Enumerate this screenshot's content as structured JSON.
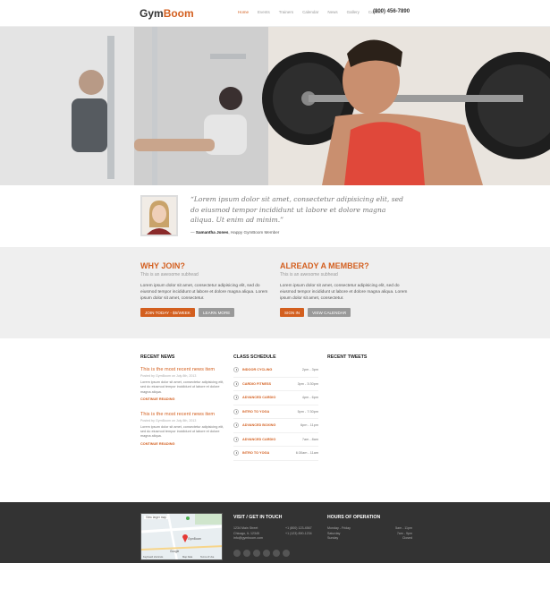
{
  "header": {
    "logo_part1": "Gym",
    "logo_part2": "Boom",
    "nav": [
      "Home",
      "Events",
      "Trainers",
      "Calendar",
      "News",
      "Gallery",
      "Contact"
    ],
    "phone": "(800) 456-7890"
  },
  "testimonial": {
    "quote": "“Lorem ipsum dolor sit amet, consectetur adipisicing elit, sed do eiusmod tempor incididunt ut labore et dolore magna aliqua. Ut enim ad minim.”",
    "author_name": "Samantha Jones",
    "author_role": ", Happy GymBoom Member"
  },
  "why_join": {
    "title": "WHY JOIN?",
    "subtitle": "This is an awesome subhead",
    "body": "Lorem ipsum dolor sit amet, consectetur adipisicing elit, sed do eiusmod tempor incididunt ut labore et dolore magna aliqua. Lorem ipsum dolor sit amet, consectetur.",
    "primary_button": "JOIN TODAY - $5/WEEK",
    "secondary_button": "LEARN MORE"
  },
  "member": {
    "title": "ALREADY A MEMBER?",
    "subtitle": "This is an awesome subhead",
    "body": "Lorem ipsum dolor sit amet, consectetur adipisicing elit, sed do eiusmod tempor incididunt ut labore et dolore magna aliqua. Lorem ipsum dolor sit amet, consectetur.",
    "primary_button": "SIGN IN",
    "secondary_button": "VIEW CALENDAR"
  },
  "news": {
    "heading": "RECENT NEWS",
    "items": [
      {
        "title": "This is the most recent news item",
        "meta": "Posted by GymBoom on July 8th, 2013",
        "body": "Lorem ipsum dolor sit amet, consectetur adipisicing elit, sed do eiusmod tempor incididunt ut labore et dolore magna aliqua.",
        "more": "CONTINUE READING"
      },
      {
        "title": "This is the most recent news item",
        "meta": "Posted by GymBoom on July 8th, 2013",
        "body": "Lorem ipsum dolor sit amet, consectetur adipisicing elit, sed do eiusmod tempor incididunt ut labore et dolore magna aliqua.",
        "more": "CONTINUE READING"
      }
    ]
  },
  "schedule": {
    "heading": "CLASS SCHEDULE",
    "rows": [
      {
        "name": "INDOOR CYCLING",
        "time": "2pm - 3pm"
      },
      {
        "name": "CARDIO FITNESS",
        "time": "3pm - 3:30pm"
      },
      {
        "name": "ADVANCED CARDIO",
        "time": "4pm - 6pm"
      },
      {
        "name": "INTRO TO YOGA",
        "time": "5pm - 7:30pm"
      },
      {
        "name": "ADVANCED BOXING",
        "time": "6pm - 11pm"
      },
      {
        "name": "ADVANCED CARDIO",
        "time": "7am - 8am"
      },
      {
        "name": "INTRO TO YOGA",
        "time": "6:30am - 11am"
      }
    ]
  },
  "tweets": {
    "heading": "RECENT TWEETS"
  },
  "footer": {
    "map_labels": [
      "View larger map",
      "GymBoom",
      "Google",
      "Keyboard shortcuts",
      "Map Data",
      "Terms of Use"
    ],
    "visit_heading": "VISIT / GET IN TOUCH",
    "visit_rows": [
      {
        "left": "1234 Main Street",
        "right": "+1 (800) 123-4567"
      },
      {
        "left": "Chicago, IL 12345",
        "right": "+1 (123) 890-1234"
      },
      {
        "left": "info@gymboom.com",
        "right": ""
      }
    ],
    "hours_heading": "HOURS OF OPERATION",
    "hours_rows": [
      {
        "day": "Monday - Friday",
        "time": "5am - 11pm"
      },
      {
        "day": "Saturday",
        "time": "7am - 9pm"
      },
      {
        "day": "Sunday",
        "time": "Closed"
      }
    ]
  },
  "colors": {
    "accent": "#d35f1f",
    "footer_bg": "#333333",
    "band_bg": "#efefef"
  }
}
